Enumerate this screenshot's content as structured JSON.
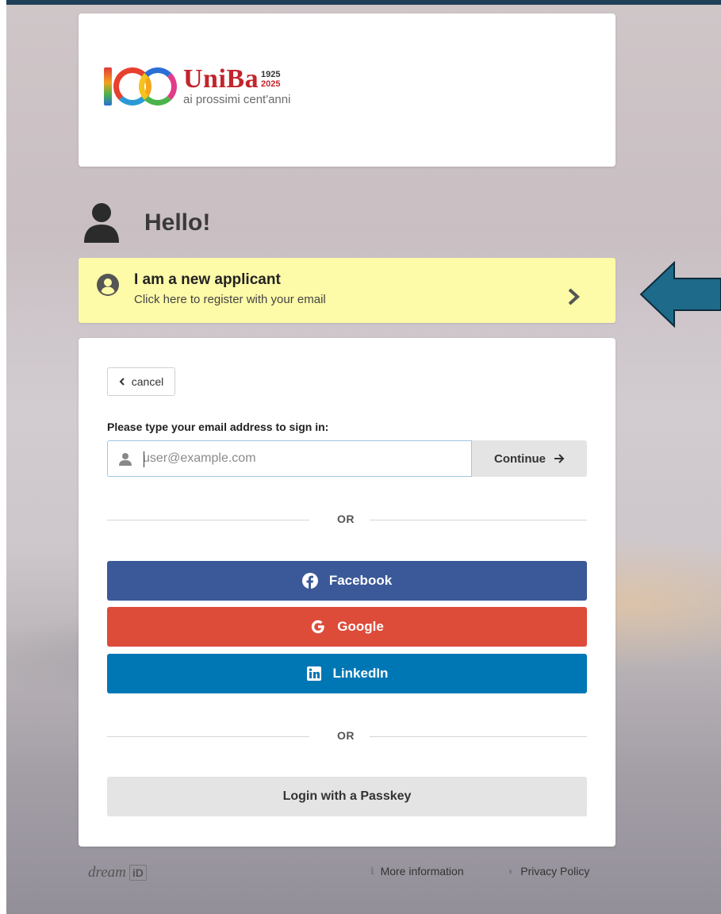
{
  "brand": {
    "name": "UniBa",
    "year_start": "1925",
    "year_end": "2025",
    "tagline": "ai prossimi cent'anni"
  },
  "greeting": {
    "text": "Hello!",
    "icon": "user-icon"
  },
  "new_applicant": {
    "title": "I am a new applicant",
    "subtitle": "Click here to register with your email",
    "icon": "user-circle-icon",
    "chevron": "chevron-right-icon",
    "background": "#fdfaa8"
  },
  "login": {
    "cancel_label": "cancel",
    "prompt": "Please type your email address to sign in:",
    "email_placeholder": "user@example.com",
    "email_value": "",
    "continue_label": "Continue",
    "or_label_1": "OR",
    "or_label_2": "OR",
    "social": [
      {
        "label": "Facebook",
        "icon": "facebook-icon",
        "color": "#3b5998"
      },
      {
        "label": "Google",
        "icon": "google-icon",
        "color": "#dd4b39"
      },
      {
        "label": "LinkedIn",
        "icon": "linkedin-icon",
        "color": "#0077b5"
      }
    ],
    "passkey_label": "Login with a Passkey"
  },
  "footer": {
    "logo_text": "dream",
    "logo_id": "iD",
    "more_info": "More information",
    "privacy": "Privacy Policy"
  },
  "colors": {
    "top_bar": "#1f4057",
    "annotation_arrow": "#1d6a8a"
  }
}
